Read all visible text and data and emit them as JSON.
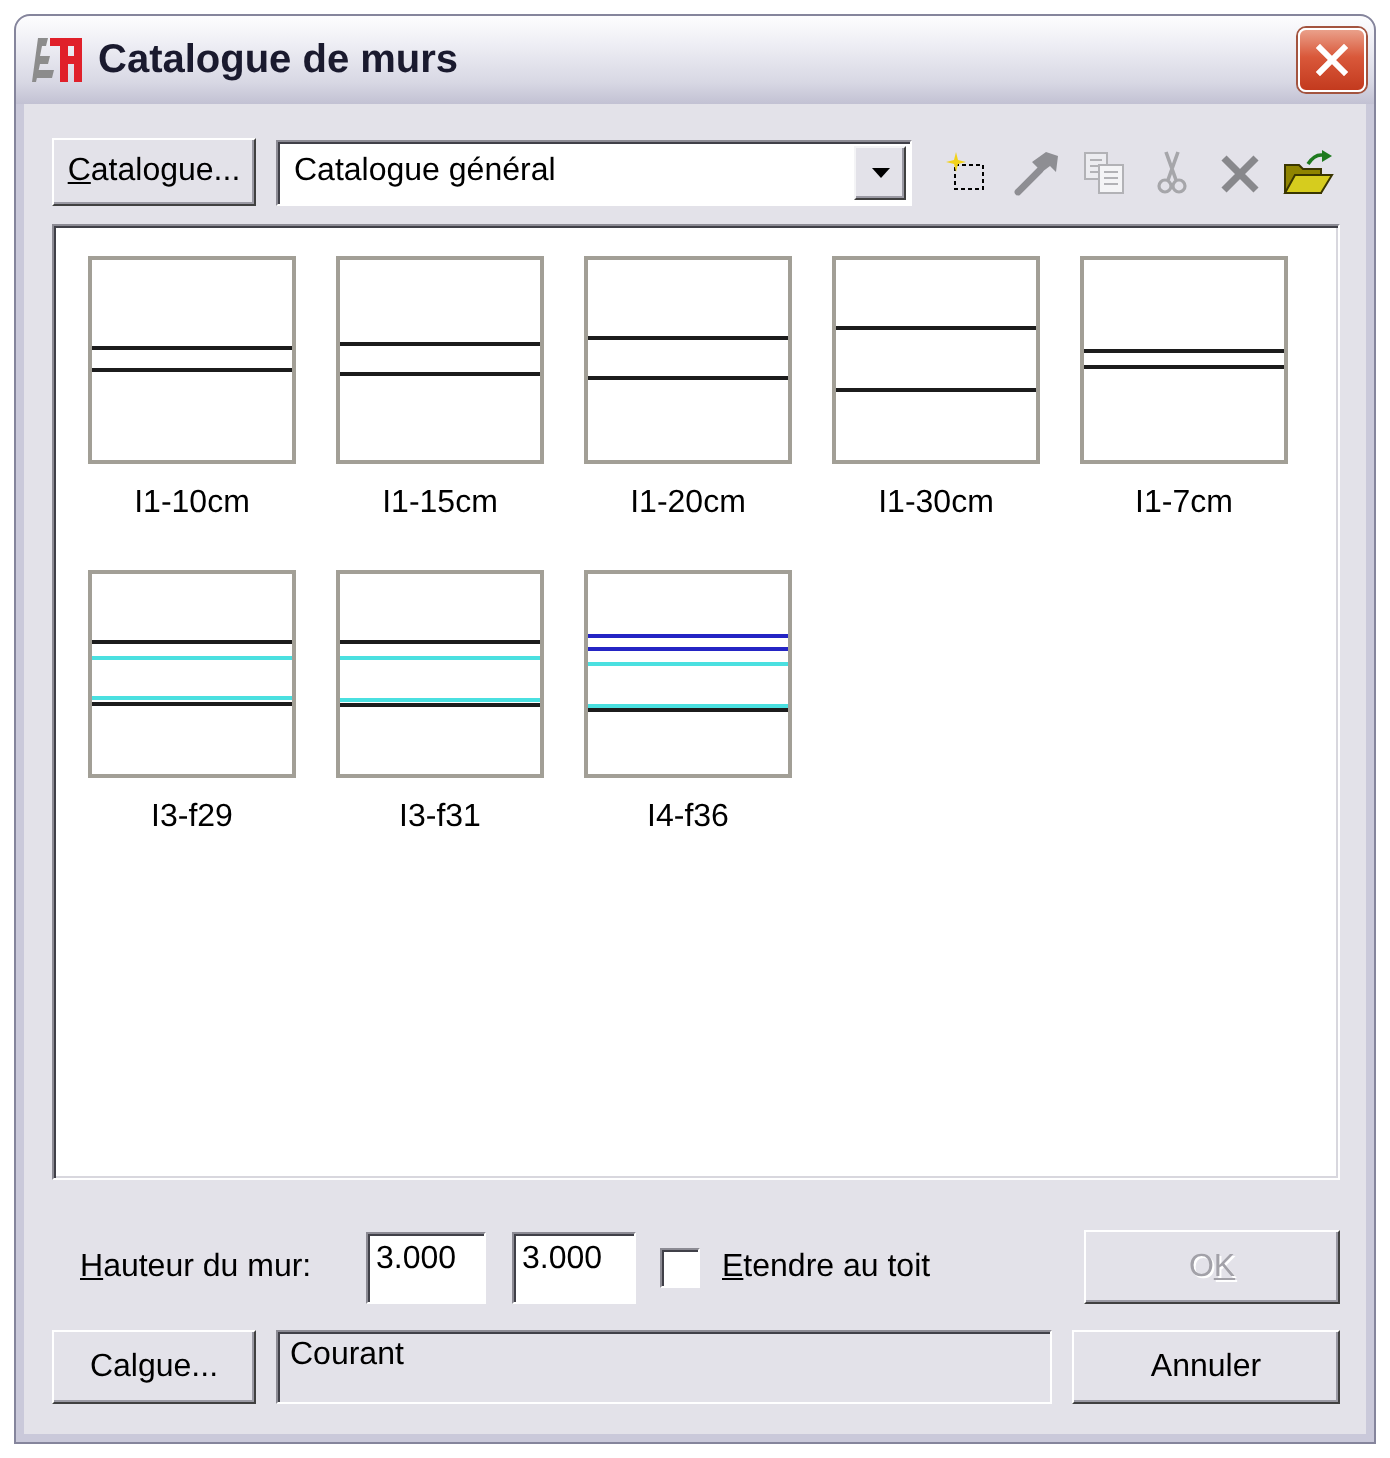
{
  "window": {
    "title": "Catalogue de murs"
  },
  "toolbar": {
    "catalogue_button": {
      "label": [
        {
          "text": "C",
          "underlined": true
        },
        {
          "text": "atalogue...",
          "underlined": false
        }
      ]
    },
    "catalogue_select": {
      "value": "Catalogue général"
    },
    "tools": [
      {
        "kind": "new",
        "disabled": false
      },
      {
        "kind": "edit",
        "disabled": true
      },
      {
        "kind": "copy",
        "disabled": true
      },
      {
        "kind": "cut",
        "disabled": true
      },
      {
        "kind": "delete",
        "disabled": true
      },
      {
        "kind": "open",
        "disabled": false
      }
    ]
  },
  "walls": [
    {
      "name": "I1-10cm",
      "selected": false
    },
    {
      "name": "I1-15cm",
      "selected": false
    },
    {
      "name": "I1-20cm",
      "selected": false
    },
    {
      "name": "I1-30cm",
      "selected": false
    },
    {
      "name": "I1-7cm",
      "selected": false
    },
    {
      "name": "I3-f29",
      "selected": false
    },
    {
      "name": "I3-f31",
      "selected": false
    },
    {
      "name": "I4-f36",
      "selected": false
    }
  ],
  "height": {
    "label": [
      {
        "text": "H",
        "underlined": true
      },
      {
        "text": "auteur du mur:",
        "underlined": false
      }
    ],
    "values": [
      "3.000",
      "3.000"
    ],
    "extend_to_roof": {
      "label": [
        {
          "text": "E",
          "underlined": true
        },
        {
          "text": "tendre au toit",
          "underlined": false
        }
      ],
      "checked": false
    }
  },
  "layer": {
    "button": {
      "label": "Calgue..."
    },
    "value": "Courant"
  },
  "buttons": {
    "ok": {
      "label": [
        {
          "text": "O",
          "underlined": false
        },
        {
          "text": "K",
          "underlined": true
        }
      ],
      "disabled": true
    },
    "cancel": {
      "label": "Annuler"
    }
  }
}
